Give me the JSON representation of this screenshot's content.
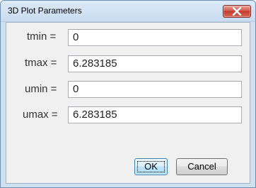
{
  "window": {
    "title": "3D Plot Parameters"
  },
  "fields": [
    {
      "label": "tmin =",
      "value": "0"
    },
    {
      "label": "tmax =",
      "value": "6.283185"
    },
    {
      "label": "umin =",
      "value": "0"
    },
    {
      "label": "umax =",
      "value": "6.283185"
    }
  ],
  "buttons": {
    "ok_label": "OK",
    "cancel_label": "Cancel"
  },
  "icons": {
    "close": "close-icon"
  },
  "colors": {
    "titlebar": "#cfe0f1",
    "close_button": "#c94a3d",
    "client_background": "#f0f0f0",
    "ok_button": "#bee6fd"
  }
}
